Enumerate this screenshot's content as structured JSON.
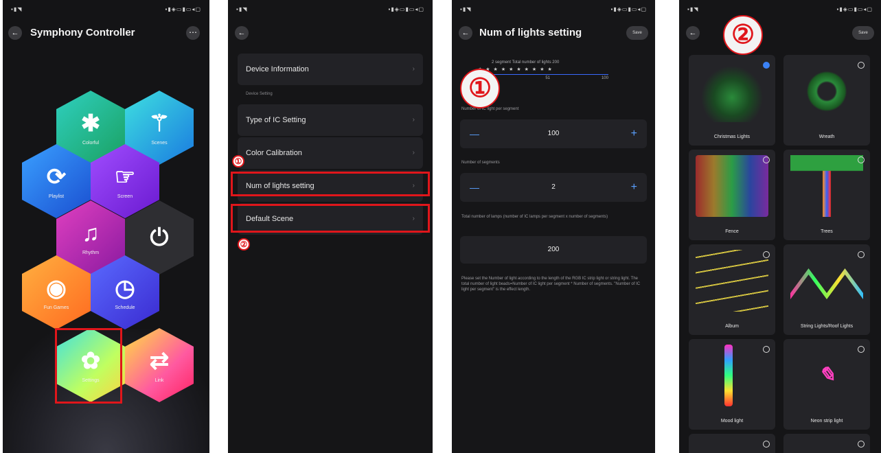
{
  "panel1": {
    "title": "Symphony Controller",
    "hexes": [
      {
        "label": "Colorful"
      },
      {
        "label": "Scenes"
      },
      {
        "label": "Playlist"
      },
      {
        "label": "Screen"
      },
      {
        "label": "Rhythm"
      },
      {
        "label": ""
      },
      {
        "label": "Fun Games"
      },
      {
        "label": "Schedule"
      },
      {
        "label": "Settings"
      },
      {
        "label": "Link"
      }
    ]
  },
  "panel2": {
    "items": {
      "device_info": "Device Information",
      "section": "Device Setting",
      "ic_type": "Type of IC Setting",
      "color_cal": "Color Calibration",
      "num_lights": "Num of lights setting",
      "default_scene": "Default Scene"
    },
    "marker1": "①",
    "marker2": "②"
  },
  "panel3": {
    "title": "Num of lights setting",
    "save": "Save",
    "segment_text": "2 segment    Total number of lights 200",
    "scale": [
      "1",
      "51",
      "100"
    ],
    "per_segment_label": "Number of IC light per segment",
    "per_segment_value": "100",
    "segments_label": "Number of segments",
    "segments_value": "2",
    "total_label": "Total number of lamps (number of IC lamps per segment x number of segments)",
    "total_value": "200",
    "note": "Please set the Number of light according to the length of the RGB IC strip light or string light. The total number of light beads=Number of IC light per segment * Number of segments. \"Number of IC light per segment\" is the effect length.",
    "marker": "①"
  },
  "panel4": {
    "save": "Save",
    "marker": "②",
    "cards": [
      {
        "name": "Christmas Lights",
        "selected": true
      },
      {
        "name": "Wreath",
        "selected": false
      },
      {
        "name": "Fence",
        "selected": false
      },
      {
        "name": "Trees",
        "selected": false
      },
      {
        "name": "Album",
        "selected": false
      },
      {
        "name": "String Lights/Roof Lights",
        "selected": false
      },
      {
        "name": "Mood light",
        "selected": false
      },
      {
        "name": "Neon strip light",
        "selected": false
      }
    ]
  },
  "colors": {
    "highlight": "#e0161b",
    "accent": "#5aa0ff",
    "background": "#141416"
  }
}
